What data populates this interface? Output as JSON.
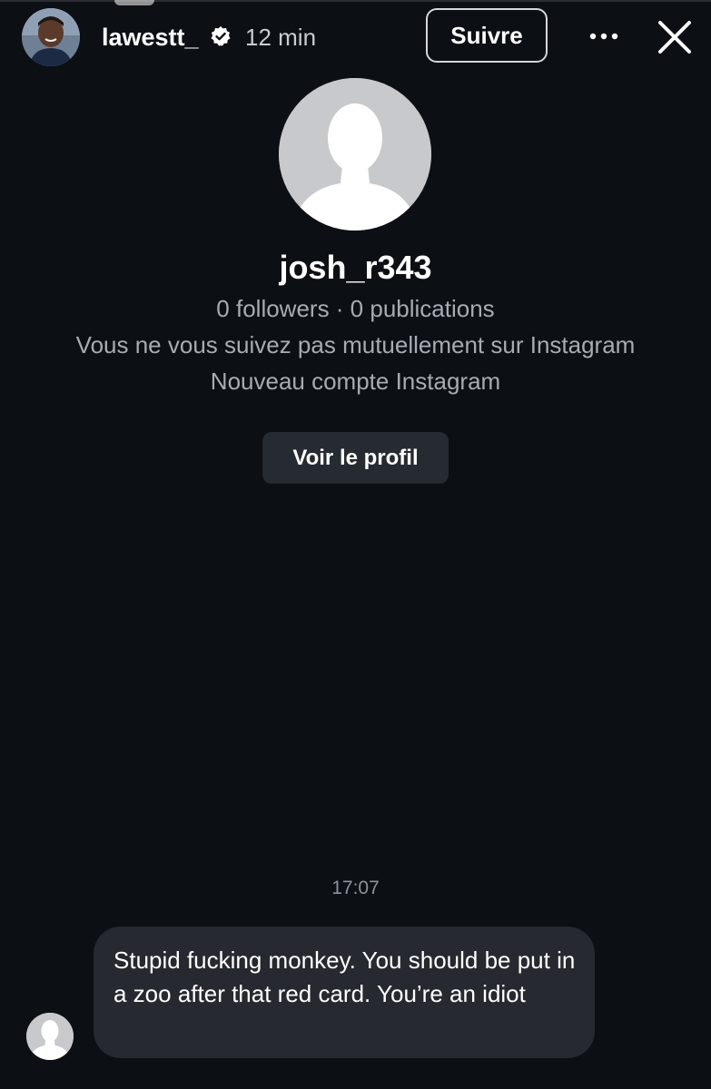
{
  "story": {
    "username": "lawestt_",
    "time": "12 min",
    "follow_label": "Suivre",
    "icons": {
      "verified": "verified-badge-icon",
      "more": "more-horizontal-icon",
      "close": "close-icon"
    }
  },
  "profile": {
    "username": "josh_r343",
    "stats": "0 followers · 0 publications",
    "mutual": "Vous ne vous suivez pas mutuellement sur Instagram",
    "new_account": "Nouveau compte Instagram",
    "view_profile_label": "Voir le profil"
  },
  "conversation": {
    "timestamp": "17:07",
    "message": "Stupid fucking monkey. You should be put in a zoo after that red card. You’re an idiot"
  },
  "colors": {
    "background": "#0c0f14",
    "bubble": "#26292f",
    "button": "#262a31",
    "muted_text": "#a8acb2"
  }
}
